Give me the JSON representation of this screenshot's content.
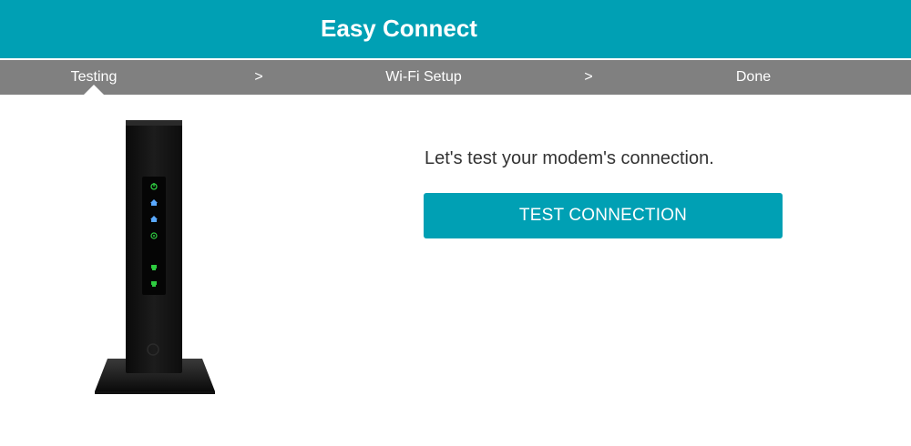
{
  "header": {
    "title": "Easy Connect",
    "background_color": "#00a0b4"
  },
  "steps": {
    "items": [
      "Testing",
      "Wi-Fi Setup",
      "Done"
    ],
    "separator": ">",
    "active_index": 0,
    "bar_color": "#808080"
  },
  "main": {
    "prompt": "Let's test your modem's connection.",
    "button_label": "TEST CONNECTION",
    "button_color": "#00a0b4"
  },
  "modem": {
    "image_name": "modem-device",
    "led_icons": [
      "power-icon",
      "downstream-icon",
      "upstream-icon",
      "online-icon",
      "phone-line-1-icon",
      "phone-line-2-icon"
    ]
  }
}
